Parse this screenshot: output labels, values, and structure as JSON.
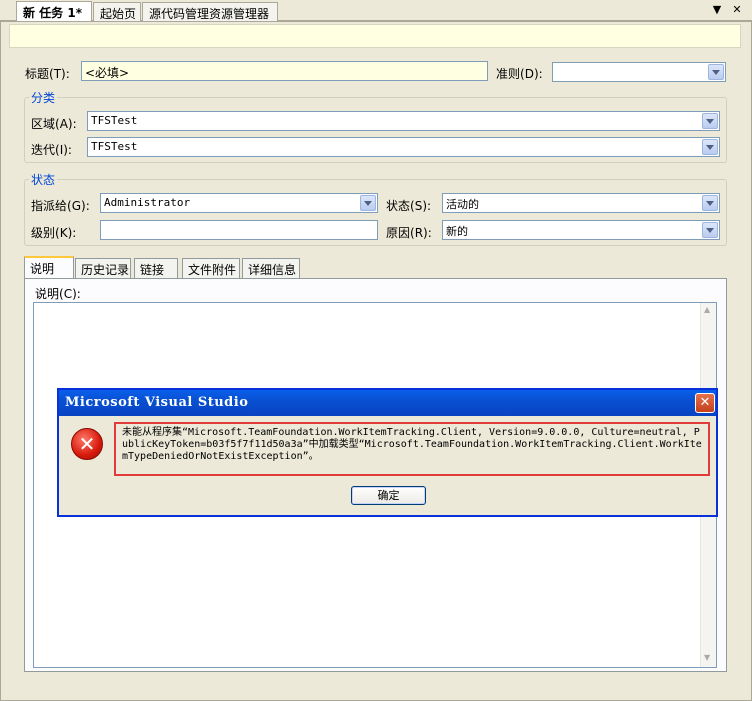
{
  "doc_tabs": [
    {
      "label": "新 任务 1*",
      "active": true
    },
    {
      "label": "起始页",
      "active": false
    },
    {
      "label": "源代码管理资源管理器",
      "active": false
    }
  ],
  "strip_icons": {
    "dropdown": "chevron-down-icon",
    "close": "close-icon"
  },
  "title_field": {
    "label": "标题",
    "key": "(T)",
    "suffix": ":",
    "value": "<必填>"
  },
  "rule_field": {
    "label": "准则",
    "key": "(D)",
    "suffix": ":",
    "value": ""
  },
  "classification": {
    "title": "分类",
    "area": {
      "label": "区域",
      "key": "(A)",
      "suffix": ":",
      "value": "TFSTest"
    },
    "iteration": {
      "label": "迭代",
      "key": "(I)",
      "suffix": ":",
      "value": "TFSTest"
    }
  },
  "status": {
    "title": "状态",
    "assigned": {
      "label": "指派给",
      "key": "(G)",
      "suffix": ":",
      "value": "Administrator"
    },
    "state": {
      "label": "状态",
      "key": "(S)",
      "suffix": ":",
      "value": "活动的"
    },
    "rank": {
      "label": "级别",
      "key": "(K)",
      "suffix": ":",
      "value": ""
    },
    "reason": {
      "label": "原因",
      "key": "(R)",
      "suffix": ":",
      "value": "新的"
    }
  },
  "panel_tabs": [
    "说明",
    "历史记录",
    "链接",
    "文件附件",
    "详细信息"
  ],
  "description": {
    "label": "说明",
    "key": "(C)",
    "suffix": ":",
    "value": ""
  },
  "dialog": {
    "title": "Microsoft Visual Studio",
    "message": "未能从程序集“Microsoft.TeamFoundation.WorkItemTracking.Client, Version=9.0.0.0, Culture=neutral, PublicKeyToken=b03f5f7f11d50a3a”中加载类型“Microsoft.TeamFoundation.WorkItemTracking.Client.WorkItemTypeDeniedOrNotExistException”。",
    "ok_label": "确定",
    "icon": "error-icon",
    "close_icon": "close-icon"
  },
  "colors": {
    "title_bar": "#0a5fea",
    "highlight_border": "#e13b3b",
    "required_field": "#ffffe1",
    "group_title": "#0046d5"
  }
}
